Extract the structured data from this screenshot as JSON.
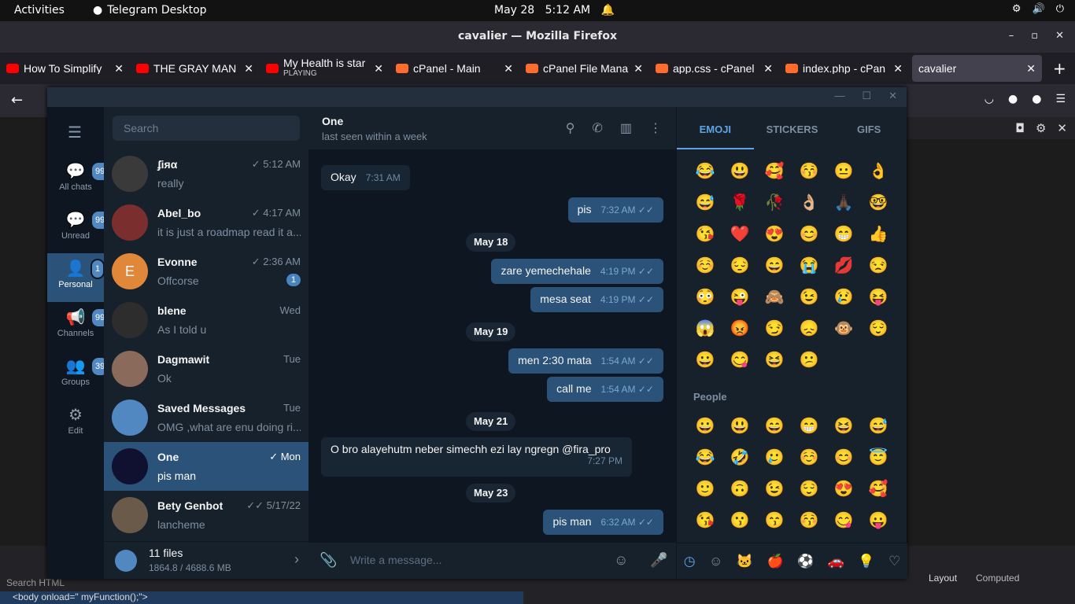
{
  "topbar": {
    "activities": "Activities",
    "app": "Telegram Desktop",
    "date": "May 28",
    "time": "5:12 AM"
  },
  "firefox": {
    "title": "cavalier — Mozilla Firefox"
  },
  "tabs": [
    {
      "title": "How To Simplify",
      "sub": "",
      "color": "#ff0000"
    },
    {
      "title": "THE GRAY MAN",
      "sub": "",
      "color": "#ff0000"
    },
    {
      "title": "My Health is star",
      "sub": "PLAYING",
      "color": "#ff0000"
    },
    {
      "title": "cPanel - Main",
      "sub": "",
      "color": "#ff6c2c"
    },
    {
      "title": "cPanel File Mana",
      "sub": "",
      "color": "#ff6c2c"
    },
    {
      "title": "app.css - cPanel",
      "sub": "",
      "color": "#ff6c2c"
    },
    {
      "title": "index.php - cPan",
      "sub": "",
      "color": "#ff6c2c"
    },
    {
      "title": "cavalier",
      "sub": "",
      "color": ""
    }
  ],
  "telegram": {
    "folders": [
      {
        "label": "All chats",
        "badge": "99+"
      },
      {
        "label": "Unread",
        "badge": "99+"
      },
      {
        "label": "Personal",
        "badge": "1"
      },
      {
        "label": "Channels",
        "badge": "99+"
      },
      {
        "label": "Groups",
        "badge": "39"
      },
      {
        "label": "Edit",
        "badge": ""
      }
    ],
    "search_placeholder": "Search",
    "chats": [
      {
        "name": "ʄiяα",
        "time": "✓ 5:12 AM",
        "preview": "really",
        "avatar": "#3a3a3a",
        "unread": ""
      },
      {
        "name": "Abel_bo",
        "time": "✓ 4:17 AM",
        "preview": "it is just a roadmap  read it a...",
        "avatar": "#7a2e2e",
        "unread": ""
      },
      {
        "name": "Evonne",
        "time": "✓ 2:36 AM",
        "preview": "Offcorse",
        "avatar": "#e0873a",
        "initial": "E",
        "unread": "1"
      },
      {
        "name": "blene",
        "time": "Wed",
        "preview": "As I told u",
        "avatar": "#2d2d2d",
        "unread": ""
      },
      {
        "name": "Dagmawit",
        "time": "Tue",
        "preview": "Ok",
        "avatar": "#8a6a5a",
        "unread": ""
      },
      {
        "name": "Saved Messages",
        "time": "Tue",
        "preview": "OMG ,what are enu doing ri...",
        "avatar": "#5288c1",
        "unread": ""
      },
      {
        "name": "One",
        "time": "✓ Mon",
        "preview": "pis man",
        "avatar": "#101030",
        "unread": ""
      },
      {
        "name": "Bety Genbot",
        "time": "✓✓ 5/17/22",
        "preview": "lancheme",
        "avatar": "#6a5a4a",
        "unread": ""
      }
    ],
    "files": {
      "count": "11 files",
      "size": "1864.8 / 4688.6 MB"
    },
    "conversation": {
      "name": "One",
      "status": "last seen within a week",
      "compose_placeholder": "Write a message...",
      "messages": [
        {
          "text": "Okay",
          "time": "7:31 AM",
          "dir": "in"
        },
        {
          "text": "pis",
          "time": "7:32 AM",
          "dir": "out"
        },
        {
          "date": "May 18"
        },
        {
          "text": "zare yemechehale",
          "time": "4:19 PM",
          "dir": "out"
        },
        {
          "text": "mesa seat",
          "time": "4:19 PM",
          "dir": "out"
        },
        {
          "date": "May 19"
        },
        {
          "text": "men 2:30 mata",
          "time": "1:54 AM",
          "dir": "out"
        },
        {
          "text": "call me",
          "time": "1:54 AM",
          "dir": "out"
        },
        {
          "date": "May 21"
        },
        {
          "text": "O bro alayehutm neber simechh ezi lay ngregn @fira_pro",
          "time": "7:27 PM",
          "dir": "in"
        },
        {
          "date": "May 23"
        },
        {
          "text": "pis man",
          "time": "6:32 AM",
          "dir": "out"
        }
      ]
    },
    "emoji_tabs": [
      "EMOJI",
      "STICKERS",
      "GIFS"
    ],
    "emoji_recent": [
      "😂",
      "😃",
      "🥰",
      "😚",
      "😐",
      "👌",
      "😅",
      "🌹",
      "🥀",
      "👌🏼",
      "🙏🏿",
      "🤓",
      "😘",
      "❤️",
      "😍",
      "😊",
      "😁",
      "👍",
      "☺️",
      "😔",
      "😄",
      "😭",
      "💋",
      "😒",
      "😳",
      "😜",
      "🙈",
      "😉",
      "😢",
      "😝",
      "😱",
      "😡",
      "😏",
      "😞",
      "🐵",
      "😌",
      "😀",
      "😋",
      "😆",
      "😕"
    ],
    "people_label": "People",
    "emoji_people": [
      "😀",
      "😃",
      "😄",
      "😁",
      "😆",
      "😅",
      "😂",
      "🤣",
      "🥲",
      "☺️",
      "😊",
      "😇",
      "🙂",
      "🙃",
      "😉",
      "😌",
      "😍",
      "🥰",
      "😘",
      "😗",
      "😙",
      "😚",
      "😋",
      "😛"
    ]
  }
}
